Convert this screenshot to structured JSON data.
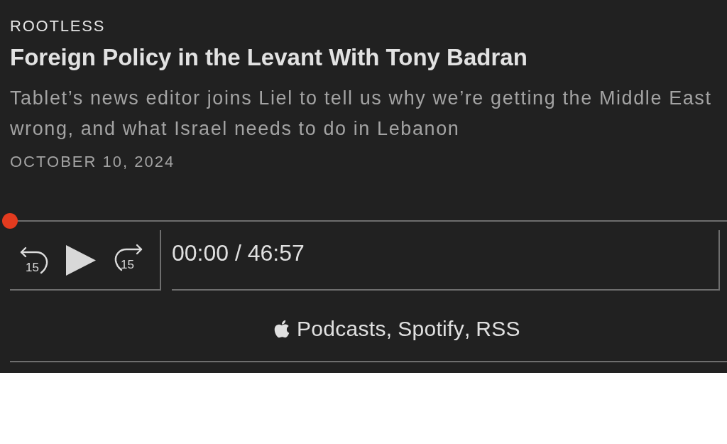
{
  "show": {
    "name": "ROOTLESS"
  },
  "episode": {
    "title": "Foreign Policy in the Levant With Tony Badran",
    "description": "Tablet’s news editor joins Liel to tell us why we’re getting the Middle East wrong, and what Israel needs to do in Lebanon",
    "date": "OCTOBER 10, 2024"
  },
  "player": {
    "level": 0,
    "playing": false,
    "skip_back": "15",
    "skip_forward": "15",
    "time": "00:00 / 46:57"
  },
  "subscribe": {
    "separator": ",",
    "links": [
      {
        "kind": "apple",
        "label": "Podcasts"
      },
      {
        "kind": "plain",
        "label": "Spotify"
      },
      {
        "kind": "plain",
        "label": "RSS"
      }
    ]
  }
}
